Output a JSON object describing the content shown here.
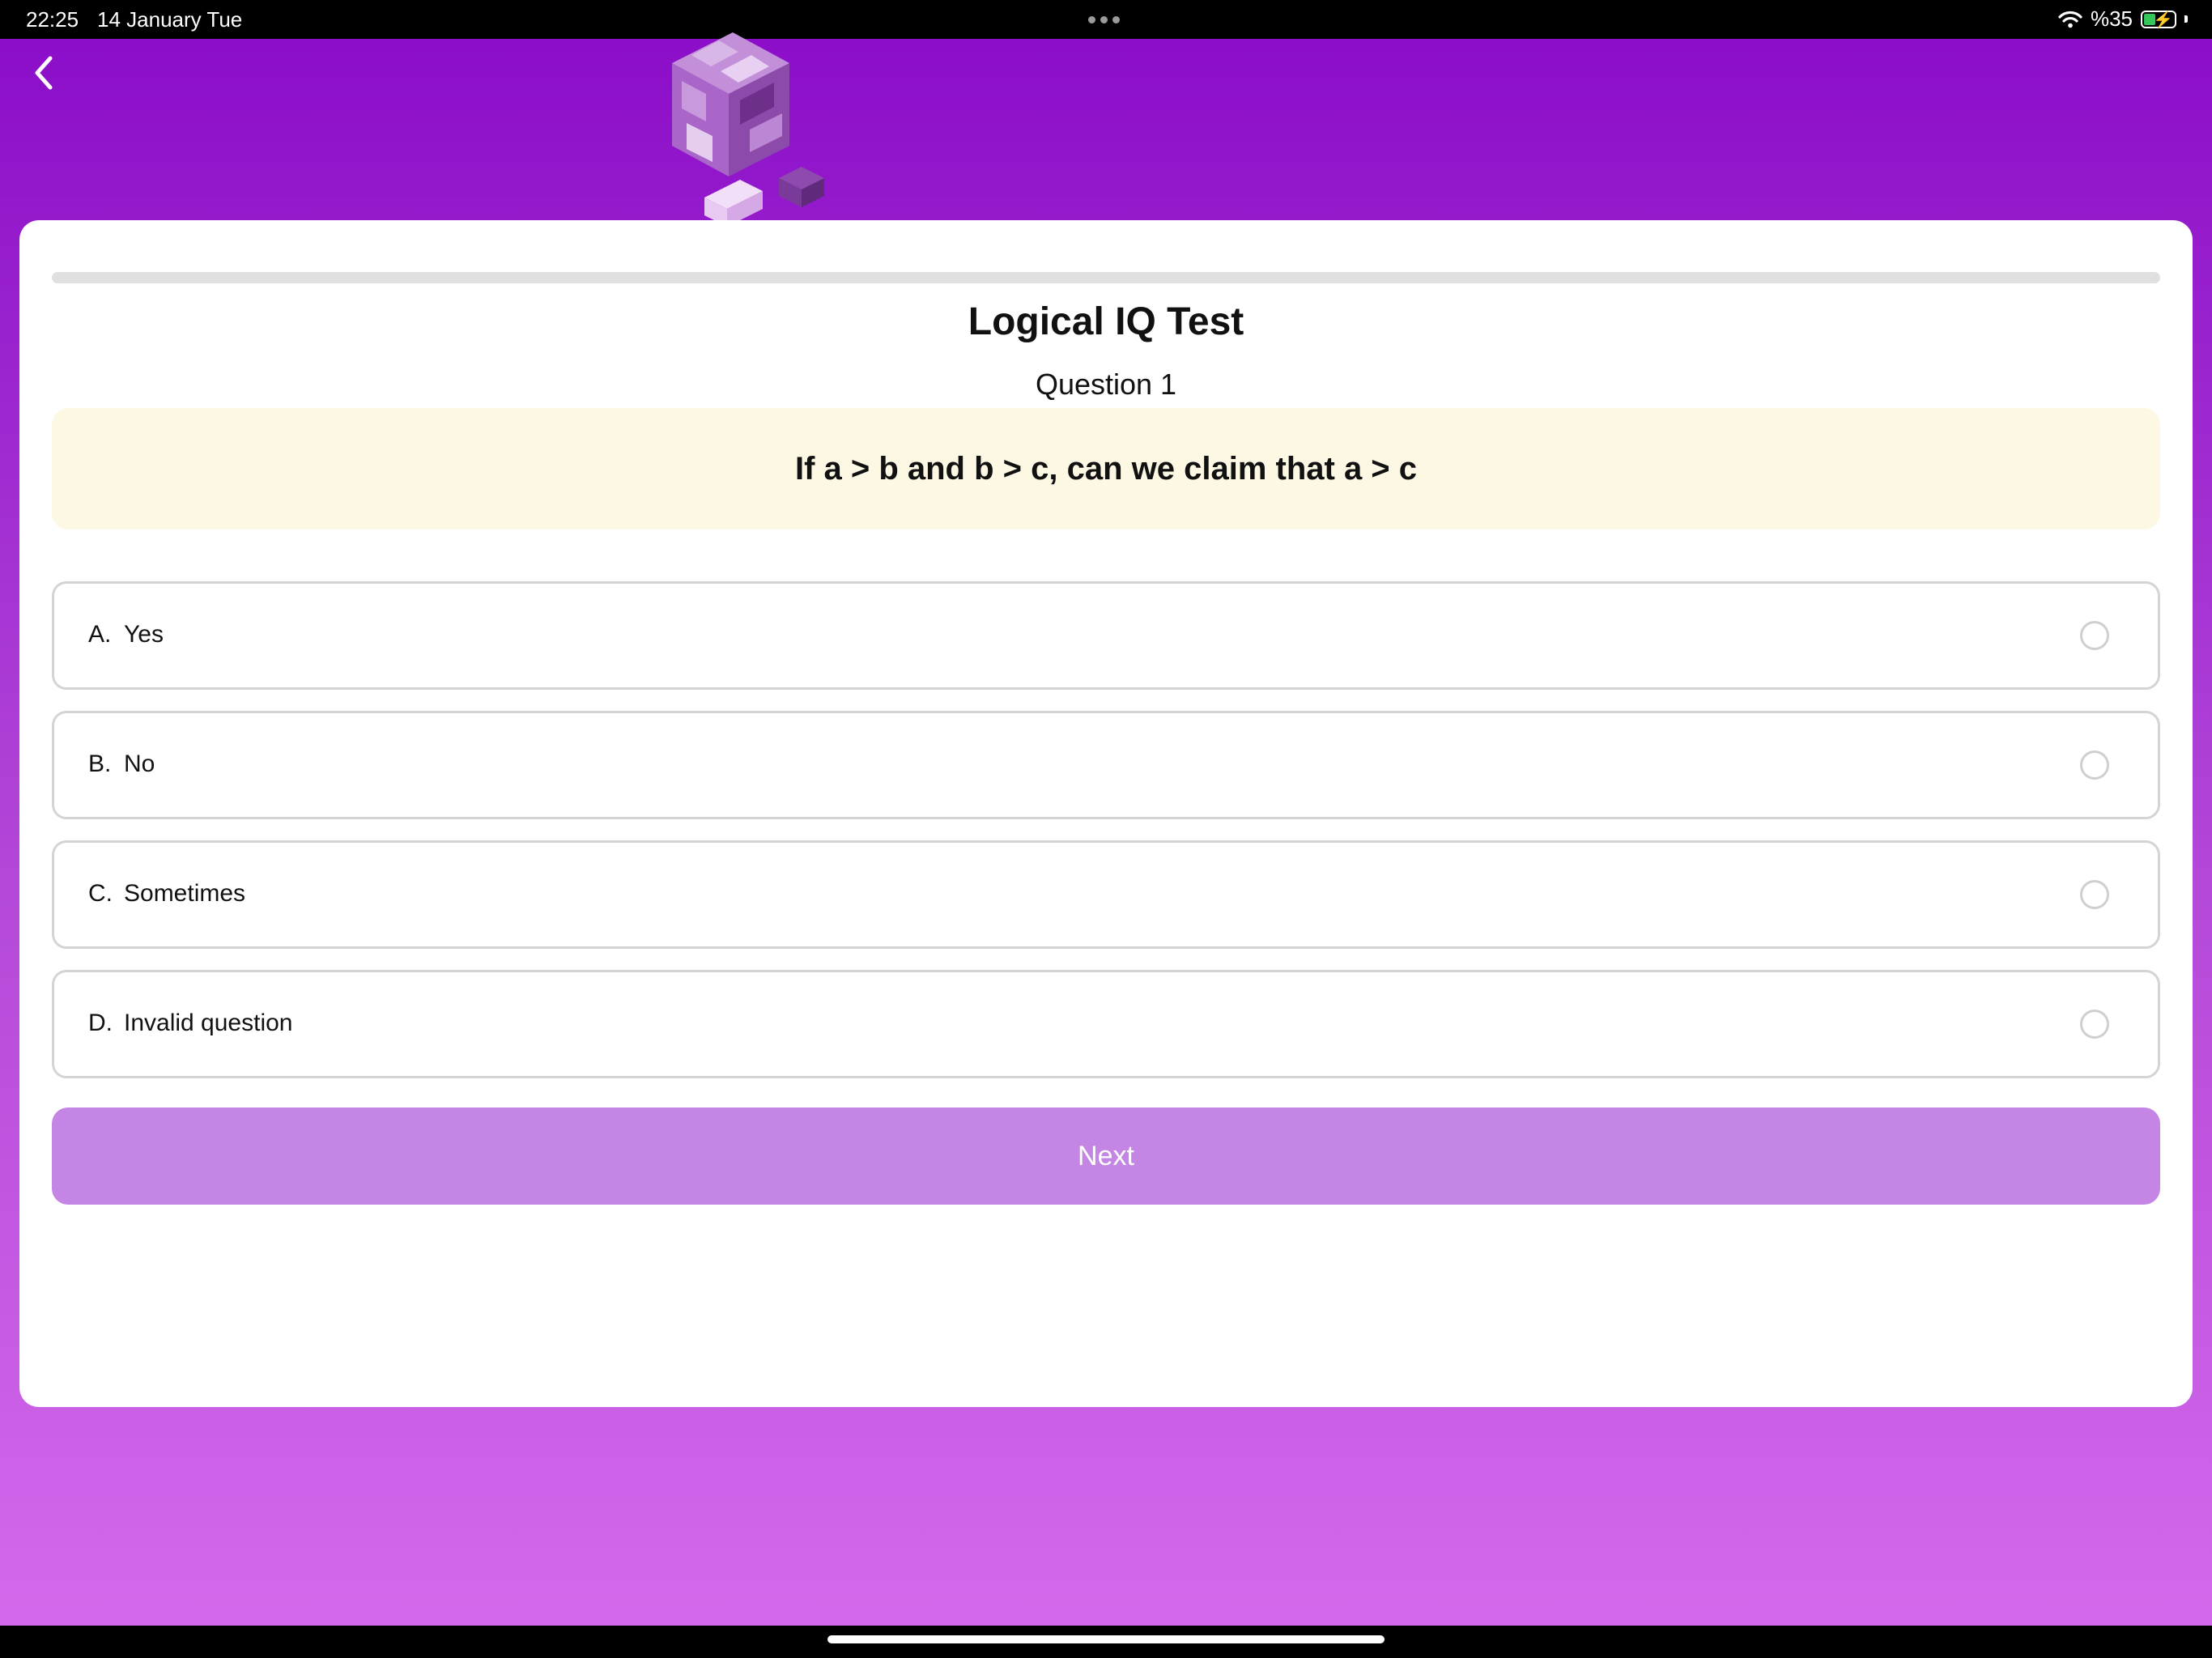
{
  "status_bar": {
    "time": "22:25",
    "date": "14 January Tue",
    "battery": "%35"
  },
  "nav": {
    "back_icon": "chevron-left-icon"
  },
  "hero": {
    "image": "puzzle-cube-illustration"
  },
  "quiz": {
    "title": "Logical IQ Test",
    "question_label": "Question 1",
    "question_text": "If a > b and b > c, can we claim that a > c",
    "progress": 0,
    "options": [
      {
        "letter": "A.",
        "text": "Yes"
      },
      {
        "letter": "B.",
        "text": "No"
      },
      {
        "letter": "C.",
        "text": "Sometimes"
      },
      {
        "letter": "D.",
        "text": "Invalid question"
      }
    ],
    "next_label": "Next"
  },
  "colors": {
    "gradient_top": "#8a0bc8",
    "gradient_bottom": "#d46aec",
    "accent_button": "#c585e4",
    "question_bg": "#fdf8e4"
  }
}
